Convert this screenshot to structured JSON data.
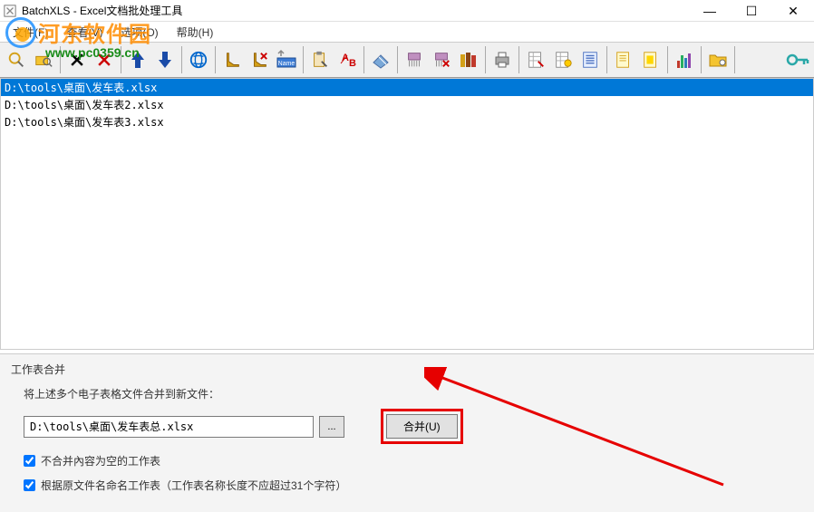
{
  "window": {
    "title": "BatchXLS - Excel文档批处理工具",
    "min_label": "—",
    "max_label": "☐",
    "close_label": "✕"
  },
  "menu": {
    "file": "文件(F)",
    "view": "查看(V)",
    "options": "选项(O)",
    "help": "帮助(H)"
  },
  "watermark": {
    "text": "河东软件园",
    "url": "www.pc0359.cn"
  },
  "files": {
    "items": [
      "D:\\tools\\桌面\\发车表.xlsx",
      "D:\\tools\\桌面\\发车表2.xlsx",
      "D:\\tools\\桌面\\发车表3.xlsx"
    ],
    "selected_index": 0
  },
  "panel": {
    "title": "工作表合并",
    "subtitle": "将上述多个电子表格文件合并到新文件：",
    "path_value": "D:\\tools\\桌面\\发车表总.xlsx",
    "browse_label": "...",
    "merge_label": "合并(U)",
    "checkbox1": "不合并內容为空的工作表",
    "checkbox2": "根据原文件名命名工作表（工作表名称长度不应超过31个字符）"
  }
}
